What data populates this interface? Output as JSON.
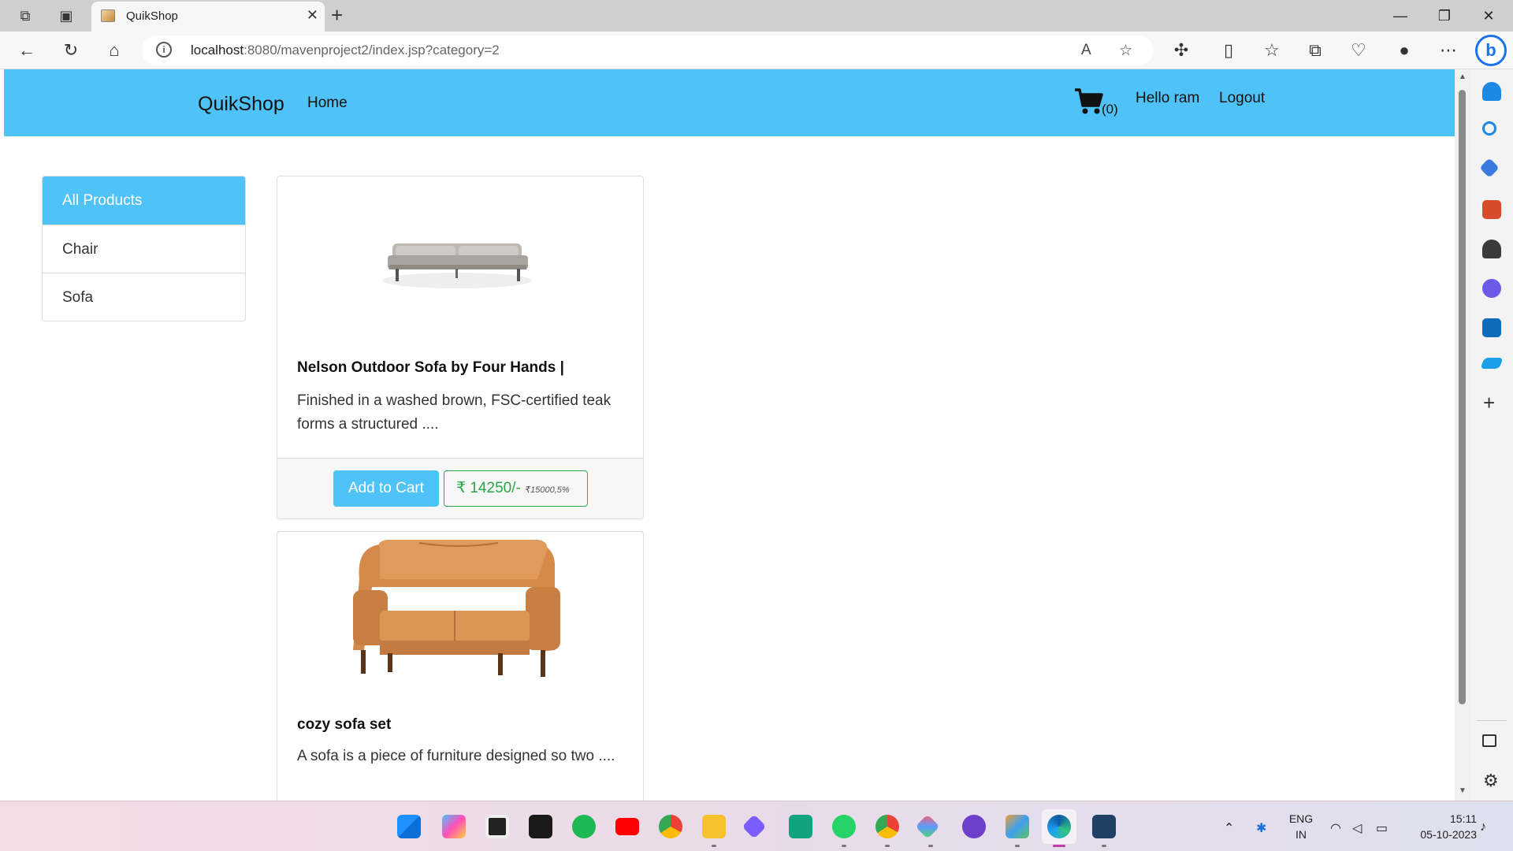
{
  "browser": {
    "tab_title": "QuikShop",
    "url_host": "localhost",
    "url_rest": ":8080/mavenproject2/index.jsp?category=2"
  },
  "site": {
    "brand": "QuikShop",
    "nav_home": "Home",
    "cart_count": "(0)",
    "greeting": "Hello ram",
    "logout": "Logout"
  },
  "categories": [
    "All Products",
    "Chair",
    "Sofa"
  ],
  "products": [
    {
      "title": "Nelson Outdoor Sofa by Four Hands |",
      "description": "Finished in a washed brown, FSC-certified teak forms a structured ....",
      "add_to_cart": "Add to Cart",
      "price": "₹ 14250/-",
      "original_discount": "₹15000,5%"
    },
    {
      "title": "cozy sofa set",
      "description": "A sofa is a piece of furniture designed so two ...."
    }
  ],
  "taskbar": {
    "lang_top": "ENG",
    "lang_bottom": "IN",
    "time": "15:11",
    "date": "05-10-2023"
  }
}
